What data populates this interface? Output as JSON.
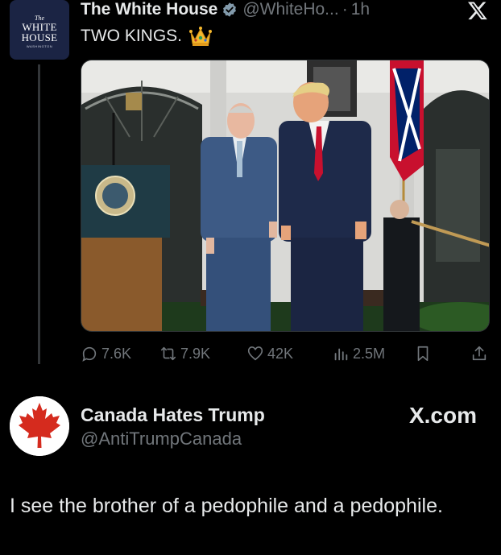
{
  "tweet": {
    "avatar": {
      "the": "The",
      "name_line1": "WHITE",
      "name_line2": "HOUSE",
      "sub": "WASHINGTON"
    },
    "display_name": "The White House",
    "handle": "@WhiteHo...",
    "separator": "·",
    "time": "1h",
    "text": "TWO KINGS.",
    "text_emoji": "crown-icon",
    "media_description_icon": "photo",
    "stats": {
      "replies": "7.6K",
      "reposts": "7.9K",
      "likes": "42K",
      "views": "2.5M"
    }
  },
  "reply": {
    "display_name": "Canada Hates Trump",
    "handle": "@AntiTrumpCanada",
    "watermark": "X.com",
    "text": "I see the brother of a pedophile and a pedophile."
  },
  "colors": {
    "background": "#000000",
    "text_primary": "#e7e9ea",
    "text_secondary": "#71767b",
    "verified": "#829aab",
    "wh_avatar_bg": "#1b2444",
    "maple_red": "#d52b1e"
  }
}
